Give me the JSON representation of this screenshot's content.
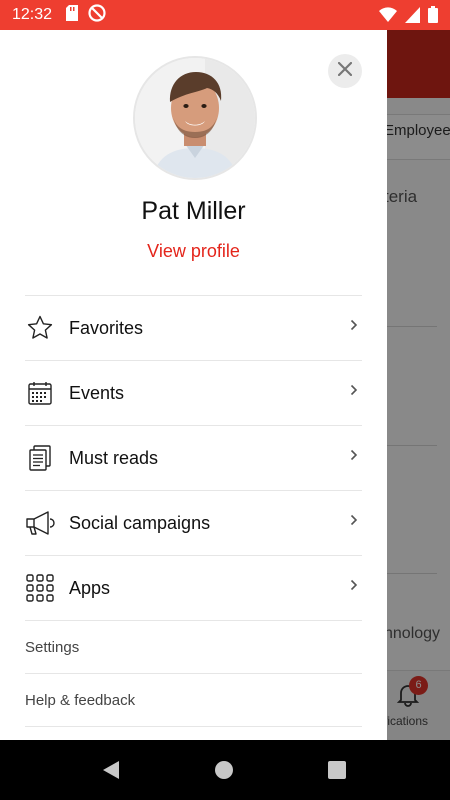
{
  "status_bar": {
    "time": "12:32",
    "bg_color": "#ee3e30"
  },
  "profile": {
    "name": "Pat Miller",
    "view_profile_label": "View profile",
    "accent_color": "#e4251b"
  },
  "menu": {
    "items": [
      {
        "label": "Favorites",
        "icon": "star-icon"
      },
      {
        "label": "Events",
        "icon": "calendar-icon"
      },
      {
        "label": "Must reads",
        "icon": "document-icon"
      },
      {
        "label": "Social campaigns",
        "icon": "megaphone-icon"
      },
      {
        "label": "Apps",
        "icon": "apps-grid-icon"
      }
    ],
    "links": [
      {
        "label": "Settings"
      },
      {
        "label": "Help & feedback"
      }
    ]
  },
  "background": {
    "tab_text": "Employee",
    "criteria_text": "teria",
    "technology_text": "hnology",
    "notifications_label": "tifications",
    "notification_badge": "6"
  }
}
